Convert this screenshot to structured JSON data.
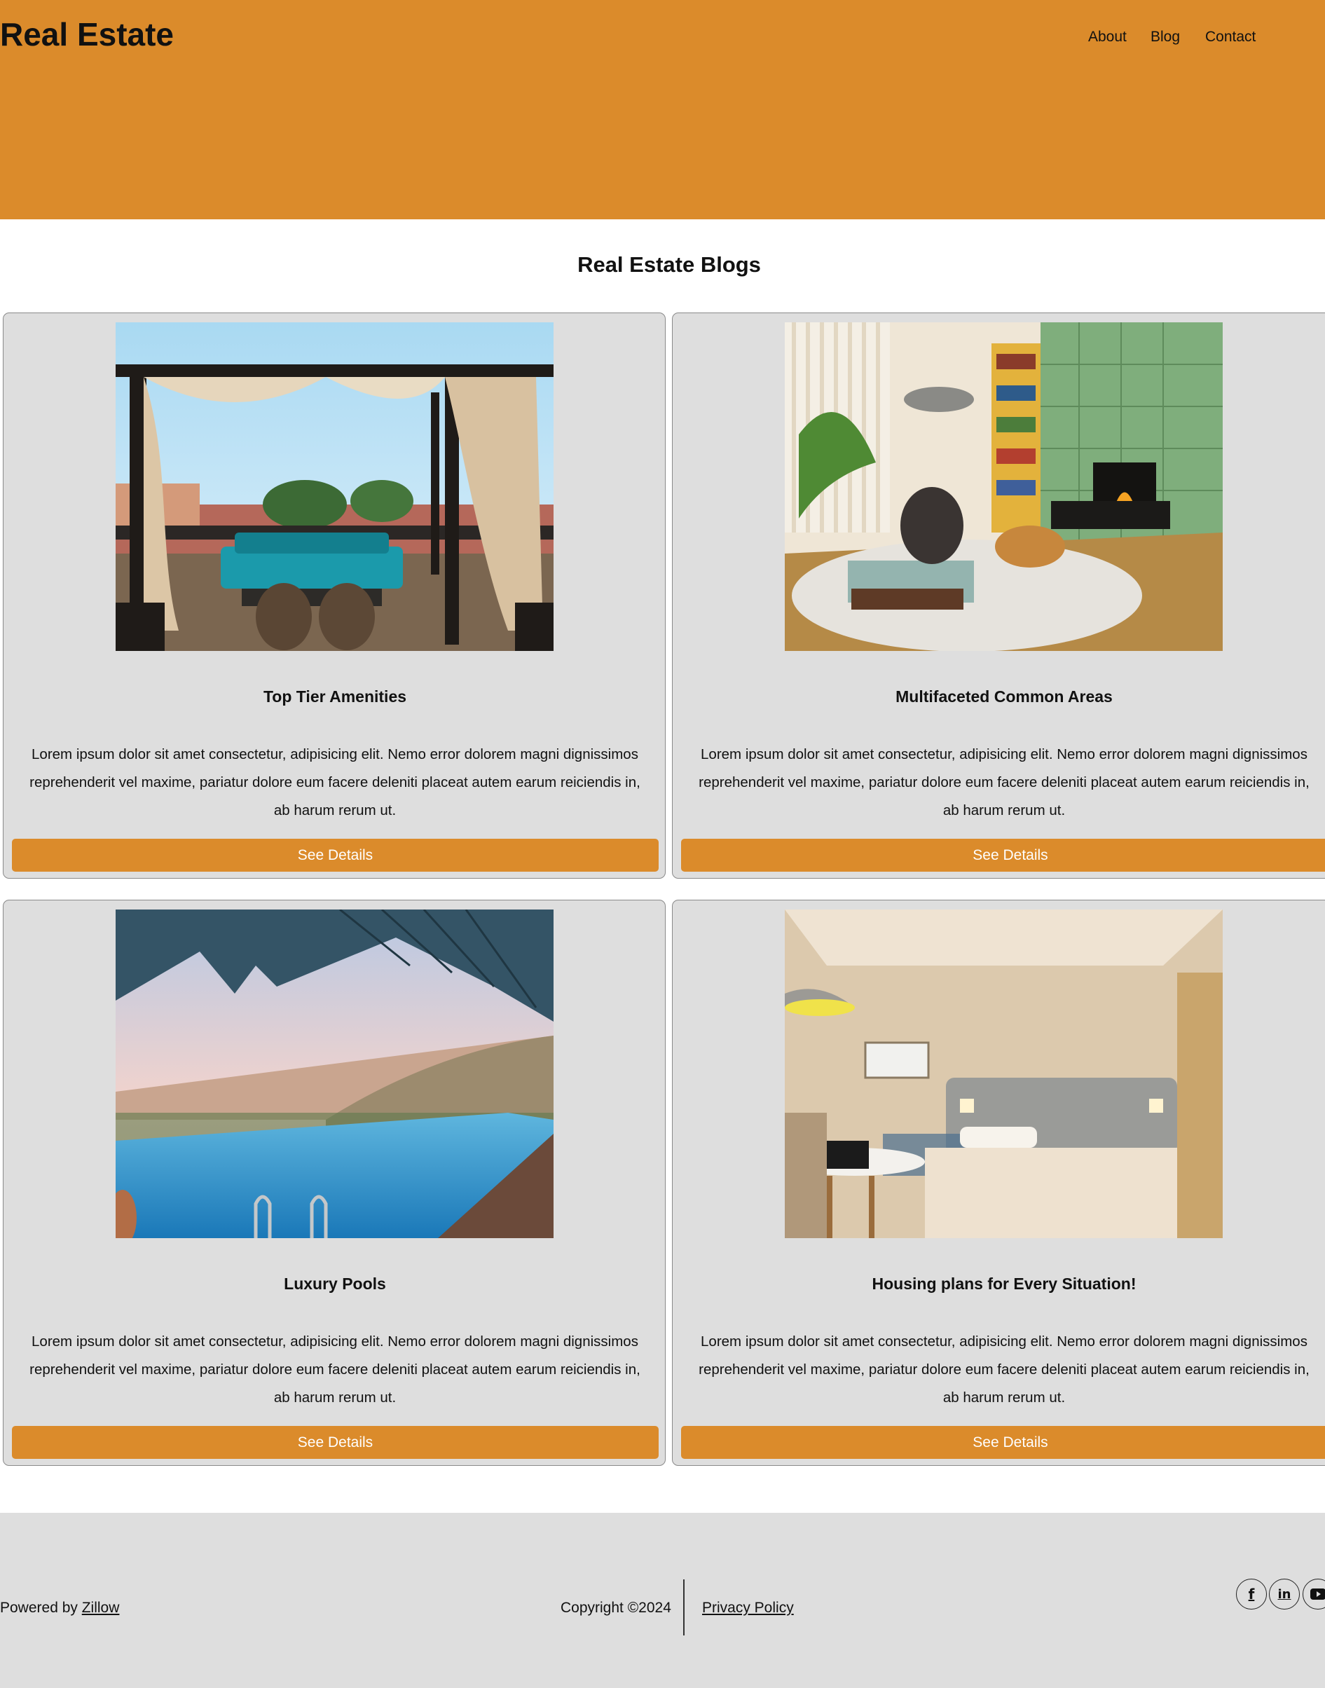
{
  "header": {
    "brand": "Real Estate",
    "nav": [
      "About",
      "Blog",
      "Contact"
    ],
    "bg_color": "#db8b2b"
  },
  "main": {
    "section_title": "Real Estate Blogs",
    "cards": [
      {
        "title": "Top Tier Amenities",
        "image": "patio-gazebo-photo",
        "text": "Lorem ipsum dolor sit amet consectetur, adipisicing elit. Nemo error dolorem magni dignissimos reprehenderit vel maxime, pariatur dolore eum facere deleniti placeat autem earum reiciendis in, ab harum rerum ut.",
        "button": "See Details"
      },
      {
        "title": "Multifaceted Common Areas",
        "image": "living-room-fireplace-photo",
        "text": "Lorem ipsum dolor sit amet consectetur, adipisicing elit. Nemo error dolorem magni dignissimos reprehenderit vel maxime, pariatur dolore eum facere deleniti placeat autem earum reiciendis in, ab harum rerum ut.",
        "button": "See Details"
      },
      {
        "title": "Luxury Pools",
        "image": "infinity-pool-photo",
        "text": "Lorem ipsum dolor sit amet consectetur, adipisicing elit. Nemo error dolorem magni dignissimos reprehenderit vel maxime, pariatur dolore eum facere deleniti placeat autem earum reiciendis in, ab harum rerum ut.",
        "button": "See Details"
      },
      {
        "title": "Housing plans for Every Situation!",
        "image": "hotel-bedroom-photo",
        "text": "Lorem ipsum dolor sit amet consectetur, adipisicing elit. Nemo error dolorem magni dignissimos reprehenderit vel maxime, pariatur dolore eum facere deleniti placeat autem earum reiciendis in, ab harum rerum ut.",
        "button": "See Details"
      }
    ]
  },
  "footer": {
    "powered_prefix": "Powered by ",
    "powered_link": "Zillow",
    "copyright": "Copyright ©2024",
    "privacy": "Privacy Policy",
    "socials": [
      "facebook-icon",
      "linkedin-icon",
      "youtube-icon"
    ]
  }
}
